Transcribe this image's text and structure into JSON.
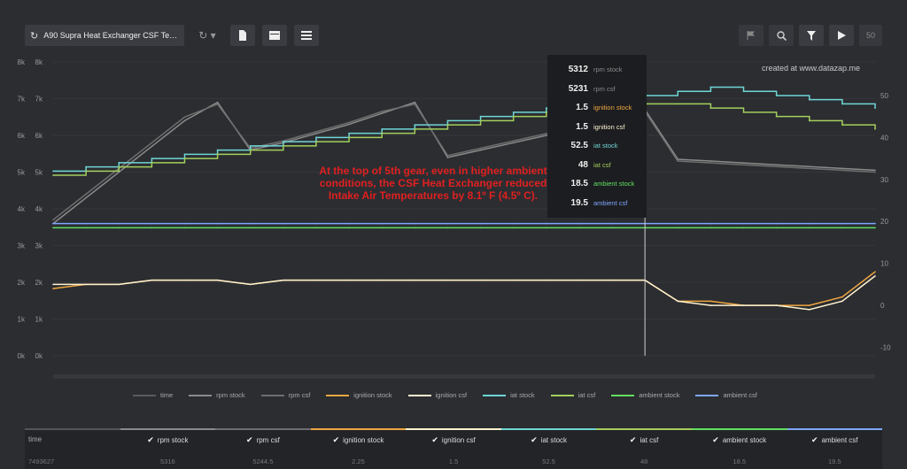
{
  "toolbar": {
    "title": "A90 Supra Heat Exchanger CSF Test F...",
    "zoom_value": "50"
  },
  "watermark": "created at www.datazap.me",
  "annotation": "At the top of 5th gear, even in higher ambient conditions, the CSF Heat Exchanger reduced Intake Air Temperatures by 8.1º F (4.5º C).",
  "tooltip": [
    {
      "value": "5312",
      "label": "rpm stock",
      "color": "#8a8a8a"
    },
    {
      "value": "5231",
      "label": "rpm csf",
      "color": "#8a8a8a"
    },
    {
      "value": "1.5",
      "label": "ignition stock",
      "color": "#f0a640"
    },
    {
      "value": "1.5",
      "label": "ignition csf",
      "color": "#fff3d0"
    },
    {
      "value": "52.5",
      "label": "iat stock",
      "color": "#6fd6d6"
    },
    {
      "value": "48",
      "label": "iat csf",
      "color": "#a4cf5c"
    },
    {
      "value": "18.5",
      "label": "ambient stock",
      "color": "#62e062"
    },
    {
      "value": "19.5",
      "label": "ambient csf",
      "color": "#7fa6ff"
    }
  ],
  "legend": [
    {
      "label": "time",
      "color": "#5a5a5a"
    },
    {
      "label": "rpm stock",
      "color": "#8a8a8a"
    },
    {
      "label": "rpm csf",
      "color": "#6e6e6e"
    },
    {
      "label": "ignition stock",
      "color": "#f0a640"
    },
    {
      "label": "ignition csf",
      "color": "#fff3d0"
    },
    {
      "label": "iat stock",
      "color": "#6fd6d6"
    },
    {
      "label": "iat csf",
      "color": "#a4cf5c"
    },
    {
      "label": "ambient stock",
      "color": "#62e062"
    },
    {
      "label": "ambient csf",
      "color": "#7fa6ff"
    }
  ],
  "table": [
    {
      "label": "time",
      "value": "7493627",
      "checked": false,
      "color": "#555555"
    },
    {
      "label": "rpm stock",
      "value": "5316",
      "checked": true,
      "color": "#8a8a8a"
    },
    {
      "label": "rpm csf",
      "value": "5244.5",
      "checked": true,
      "color": "#6e6e6e"
    },
    {
      "label": "ignition stock",
      "value": "2.25",
      "checked": true,
      "color": "#f0a640"
    },
    {
      "label": "ignition csf",
      "value": "1.5",
      "checked": true,
      "color": "#fff3d0"
    },
    {
      "label": "iat stock",
      "value": "52.5",
      "checked": true,
      "color": "#6fd6d6"
    },
    {
      "label": "iat csf",
      "value": "48",
      "checked": true,
      "color": "#a4cf5c"
    },
    {
      "label": "ambient stock",
      "value": "18.5",
      "checked": true,
      "color": "#62e062"
    },
    {
      "label": "ambient csf",
      "value": "19.5",
      "checked": true,
      "color": "#7fa6ff"
    }
  ],
  "chart_data": {
    "type": "line",
    "title": "",
    "x": [
      0,
      4,
      8,
      12,
      16,
      20,
      24,
      28,
      32,
      36,
      40,
      44,
      48,
      52,
      56,
      60,
      64,
      68,
      72,
      76,
      80,
      84,
      88,
      92,
      96,
      100
    ],
    "left_axis": {
      "ticks": [
        "8k",
        "7k",
        "6k",
        "5k",
        "4k",
        "3k",
        "2k",
        "1k",
        "0k"
      ],
      "range": [
        0,
        8000
      ]
    },
    "right_axis": {
      "ticks": [
        "50",
        "40",
        "30",
        "20",
        "10",
        "0",
        "-10"
      ],
      "range": [
        -12,
        58
      ]
    },
    "series": [
      {
        "name": "rpm stock",
        "axis": "left",
        "values": [
          3600,
          4300,
          5000,
          5700,
          6400,
          6900,
          5600,
          5800,
          6050,
          6300,
          6600,
          6900,
          5400,
          5600,
          5800,
          6000,
          6200,
          6400,
          6700,
          5350,
          5300,
          5250,
          5200,
          5150,
          5100,
          5050
        ]
      },
      {
        "name": "rpm csf",
        "axis": "left",
        "values": [
          3700,
          4400,
          5100,
          5800,
          6500,
          6850,
          5650,
          5850,
          6100,
          6350,
          6650,
          6850,
          5450,
          5650,
          5850,
          6050,
          6250,
          6450,
          6650,
          5300,
          5250,
          5200,
          5150,
          5100,
          5050,
          5000
        ]
      },
      {
        "name": "ignition stock",
        "axis": "right",
        "values": [
          4,
          5,
          5,
          6,
          6,
          6,
          5,
          6,
          6,
          6,
          6,
          6,
          6,
          6,
          6,
          6,
          6,
          6,
          6,
          1,
          1,
          0,
          0,
          0,
          2,
          8
        ]
      },
      {
        "name": "ignition csf",
        "axis": "right",
        "values": [
          5,
          5,
          5,
          6,
          6,
          6,
          5,
          6,
          6,
          6,
          6,
          6,
          6,
          6,
          6,
          6,
          6,
          6,
          6,
          1,
          0,
          0,
          0,
          -1,
          1,
          7
        ]
      },
      {
        "name": "iat stock",
        "axis": "right",
        "values": [
          32,
          33,
          34,
          35,
          36,
          37,
          38,
          39,
          40,
          41,
          42,
          43,
          44,
          45,
          46,
          47,
          48,
          49,
          50,
          51,
          52,
          51,
          50,
          49,
          48,
          47
        ]
      },
      {
        "name": "iat csf",
        "axis": "right",
        "values": [
          31,
          32,
          33,
          34,
          35,
          36,
          37,
          38,
          39,
          40,
          41,
          42,
          43,
          44,
          45,
          46,
          47,
          48,
          48,
          48,
          47,
          46,
          45,
          44,
          43,
          42
        ]
      },
      {
        "name": "ambient stock",
        "axis": "right",
        "values": [
          18.5,
          18.5,
          18.5,
          18.5,
          18.5,
          18.5,
          18.5,
          18.5,
          18.5,
          18.5,
          18.5,
          18.5,
          18.5,
          18.5,
          18.5,
          18.5,
          18.5,
          18.5,
          18.5,
          18.5,
          18.5,
          18.5,
          18.5,
          18.5,
          18.5,
          18.5
        ]
      },
      {
        "name": "ambient csf",
        "axis": "right",
        "values": [
          19.5,
          19.5,
          19.5,
          19.5,
          19.5,
          19.5,
          19.5,
          19.5,
          19.5,
          19.5,
          19.5,
          19.5,
          19.5,
          19.5,
          19.5,
          19.5,
          19.5,
          19.5,
          19.5,
          19.5,
          19.5,
          19.5,
          19.5,
          19.5,
          19.5,
          19.5
        ]
      }
    ],
    "cursor_x": 72,
    "grid": true
  }
}
